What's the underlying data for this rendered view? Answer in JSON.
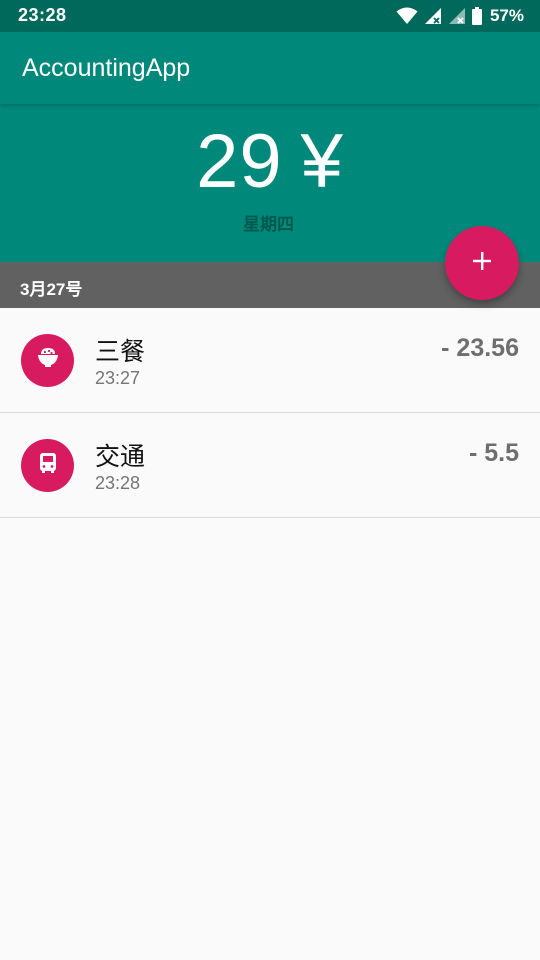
{
  "status_bar": {
    "time": "23:28",
    "battery_percent": "57%",
    "icons": [
      "wifi-icon",
      "signal-icon",
      "signal-icon",
      "battery-icon"
    ]
  },
  "app_bar": {
    "title": "AccountingApp"
  },
  "summary": {
    "amount": "29",
    "currency": "¥",
    "weekday": "星期四"
  },
  "date_header": {
    "label": "3月27号"
  },
  "fab": {
    "icon": "plus-icon",
    "label": "+"
  },
  "records": [
    {
      "category": "三餐",
      "time": "23:27",
      "amount": "- 23.56",
      "icon": "rice-bowl-icon"
    },
    {
      "category": "交通",
      "time": "23:28",
      "amount": "- 5.5",
      "icon": "bus-icon"
    }
  ],
  "colors": {
    "status_bar": "#00695c",
    "primary": "#00897b",
    "accent": "#d81b60",
    "date_bar": "#616161",
    "amount_text": "#6e6e6e"
  }
}
